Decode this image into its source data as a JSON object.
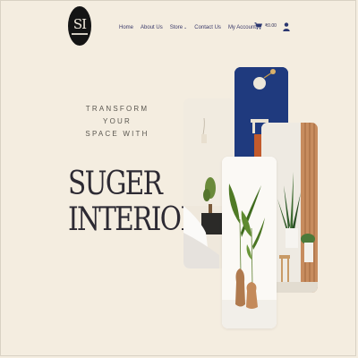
{
  "header": {
    "logo": {
      "monogram": "SI",
      "icon": "brand-logo-icon"
    },
    "nav": [
      {
        "label": "Home"
      },
      {
        "label": "About Us"
      },
      {
        "label": "Store",
        "has_dropdown": true,
        "dropdown_icon": "chevron-down-icon"
      },
      {
        "label": "Contact Us"
      },
      {
        "label": "My Account"
      }
    ],
    "cart": {
      "icon": "cart-icon",
      "amount": "₹0.00"
    },
    "user": {
      "icon": "user-icon"
    }
  },
  "hero": {
    "tagline_line1": "TRANSFORM YOUR",
    "tagline_line2": "SPACE WITH",
    "title_line1": "SUGER",
    "title_line2": "INTERIORS"
  },
  "gallery": [
    {
      "name": "navy-wall-photo"
    },
    {
      "name": "bedroom-photo"
    },
    {
      "name": "white-room-plant-photo"
    },
    {
      "name": "vase-plants-photo"
    }
  ],
  "colors": {
    "background": "#f4ede0",
    "nav_text": "#3a3a6a",
    "accent_navy": "#1f3a7e",
    "title_text": "#2d2a33"
  }
}
